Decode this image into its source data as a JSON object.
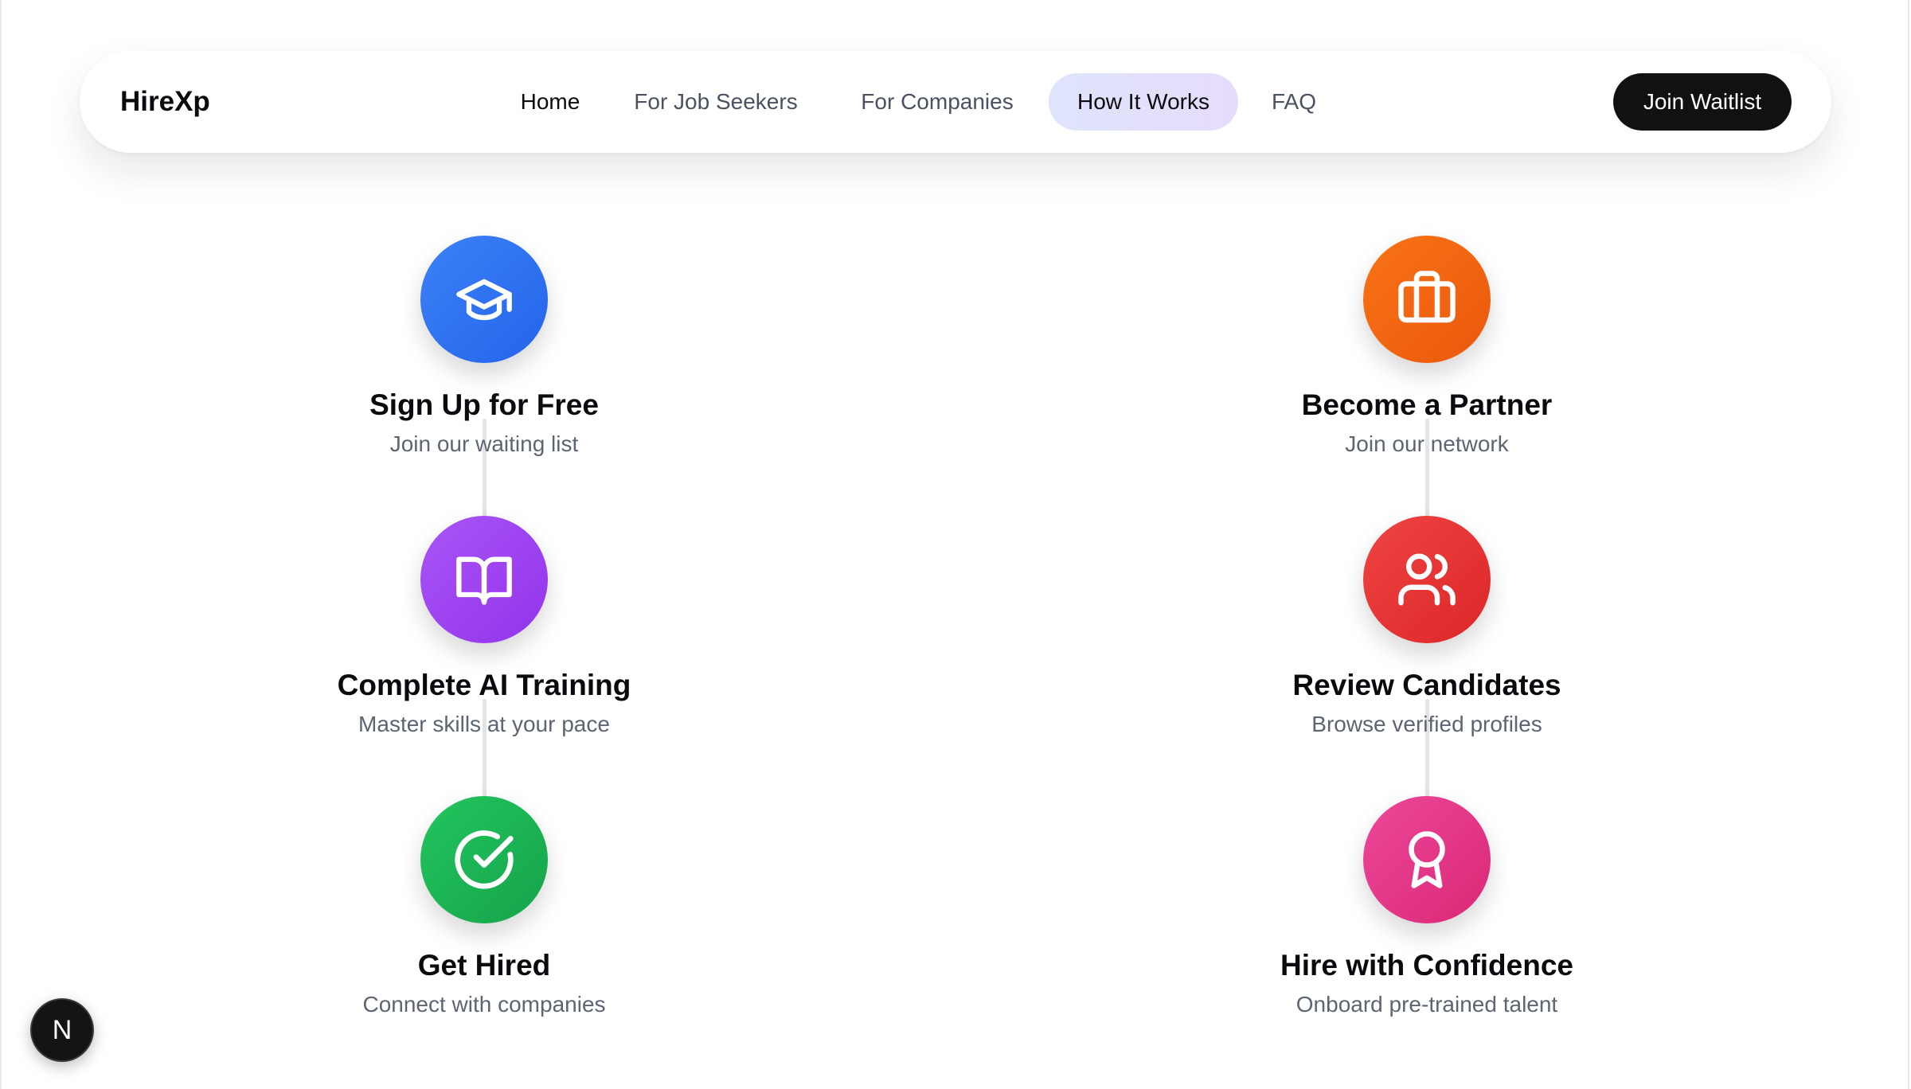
{
  "header": {
    "brand": "HireXp",
    "nav": [
      {
        "label": "Home"
      },
      {
        "label": "For Job Seekers"
      },
      {
        "label": "For Companies"
      },
      {
        "label": "How It Works",
        "active": true
      },
      {
        "label": "FAQ"
      }
    ],
    "cta": "Join Waitlist"
  },
  "seekers": {
    "steps": [
      {
        "title": "Sign Up for Free",
        "desc": "Join our waiting list",
        "icon": "graduation-cap-icon",
        "color": "#3b82f6"
      },
      {
        "title": "Complete AI Training",
        "desc": "Master skills at your pace",
        "icon": "book-open-icon",
        "color": "#a855f7"
      },
      {
        "title": "Get Hired",
        "desc": "Connect with companies",
        "icon": "check-circle-icon",
        "color": "#22c55e"
      }
    ]
  },
  "companies": {
    "steps": [
      {
        "title": "Become a Partner",
        "desc": "Join our network",
        "icon": "briefcase-icon",
        "color": "#f97316"
      },
      {
        "title": "Review Candidates",
        "desc": "Browse verified profiles",
        "icon": "users-icon",
        "color": "#ef4444"
      },
      {
        "title": "Hire with Confidence",
        "desc": "Onboard pre-trained talent",
        "icon": "award-icon",
        "color": "#ec4899"
      }
    ]
  },
  "dev_badge": {
    "letter": "N"
  }
}
